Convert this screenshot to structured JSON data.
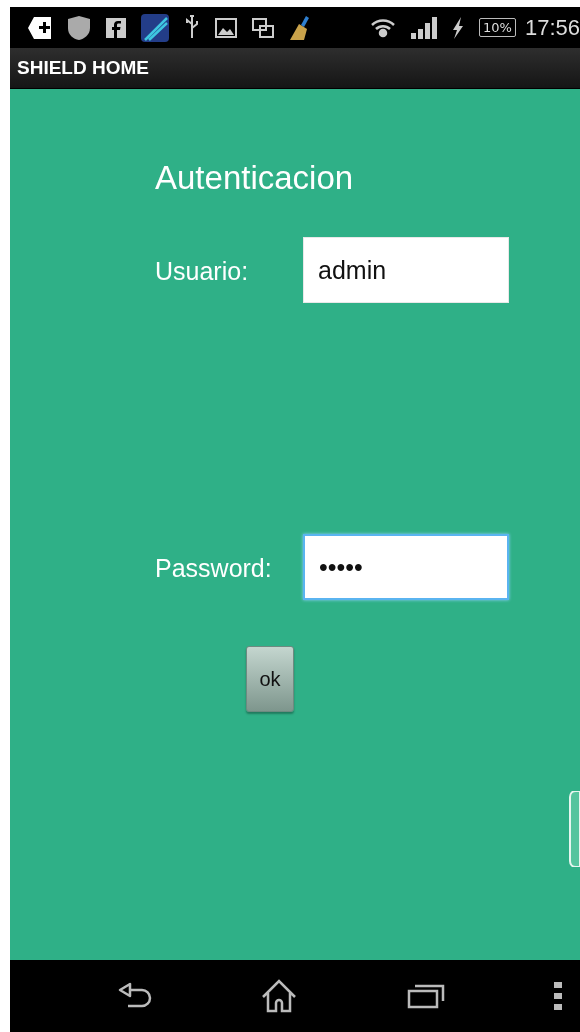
{
  "status_bar": {
    "battery": "10%",
    "time": "17:56"
  },
  "action_bar": {
    "title": "SHIELD HOME"
  },
  "form": {
    "title": "Autenticacion",
    "fields": [
      {
        "label": "Usuario:",
        "value": "admin",
        "focused": false
      },
      {
        "label": "Password:",
        "value": "•••••",
        "focused": true
      }
    ],
    "button": "ok"
  }
}
